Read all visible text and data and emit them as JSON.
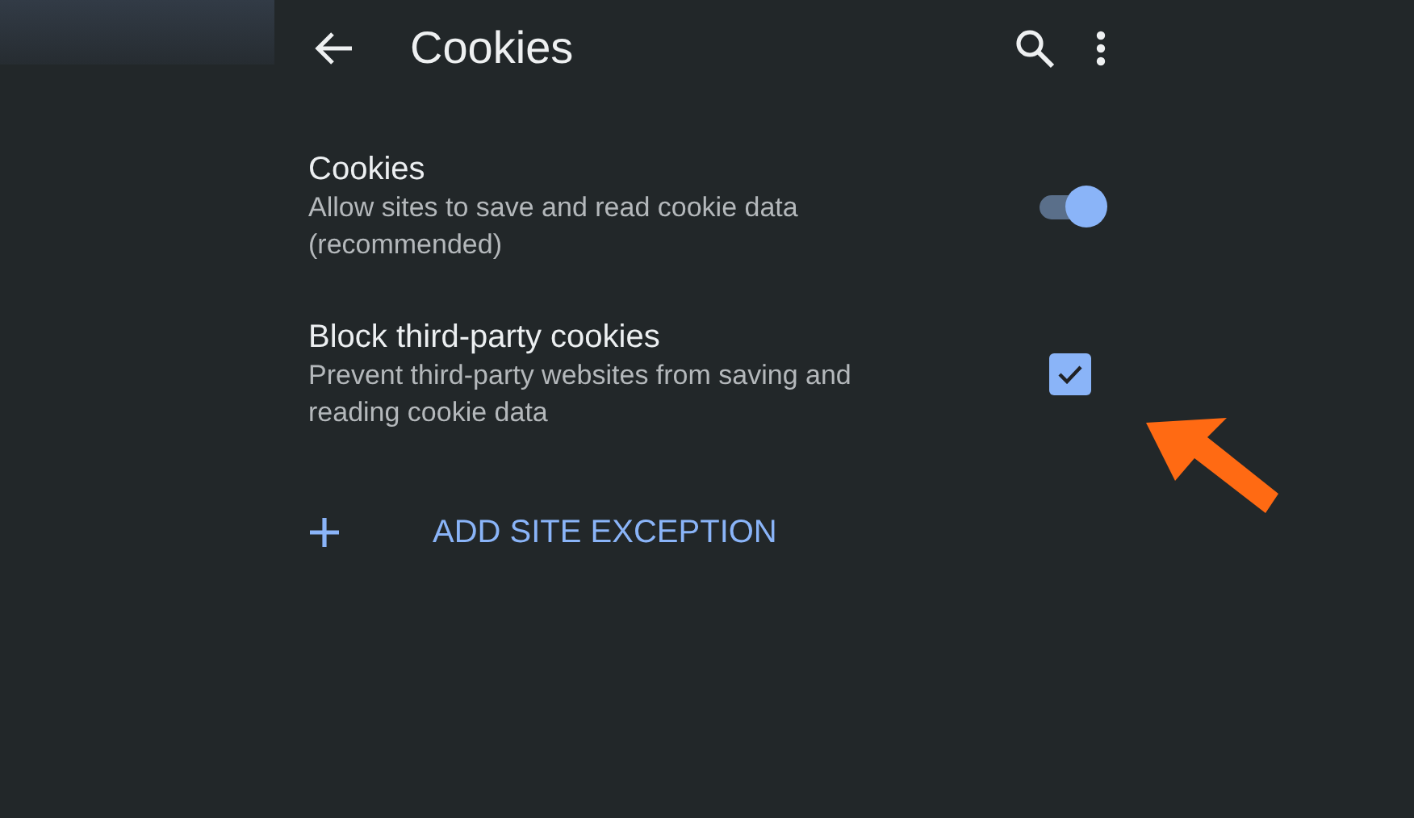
{
  "header": {
    "title": "Cookies"
  },
  "settings": [
    {
      "kind": "switch",
      "title": "Cookies",
      "description": "Allow sites to save and read cookie data (recommended)",
      "on": true
    },
    {
      "kind": "checkbox",
      "title": "Block third-party cookies",
      "description": "Prevent third-party websites from saving and reading cookie data",
      "checked": true
    }
  ],
  "add_exception": {
    "label": "ADD SITE EXCEPTION"
  }
}
